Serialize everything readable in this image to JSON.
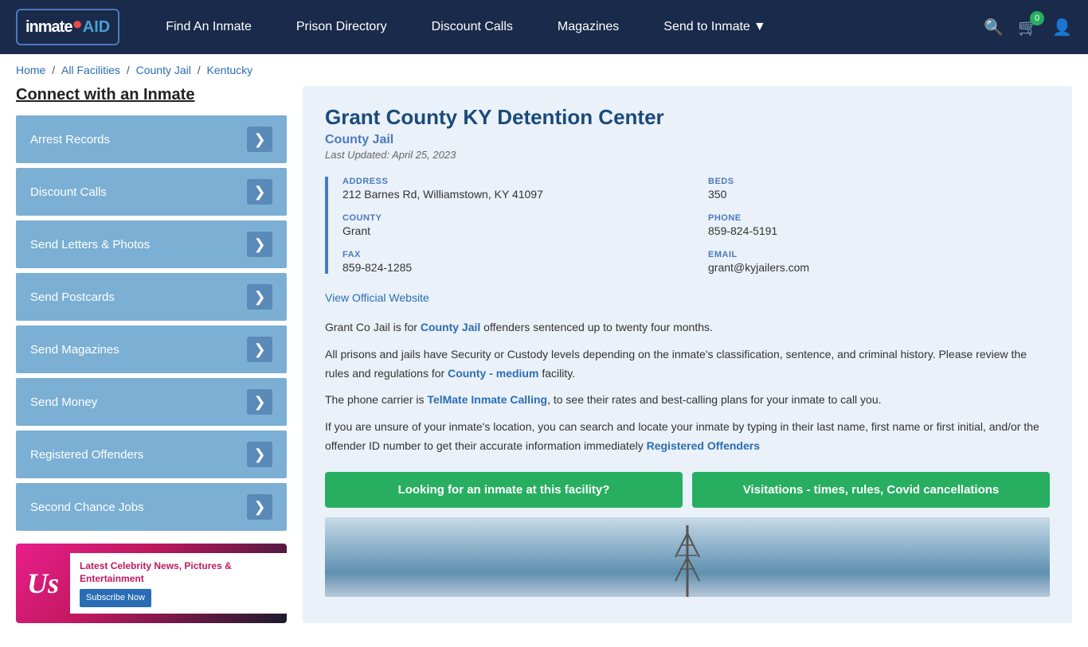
{
  "nav": {
    "logo_text": "inmate",
    "logo_aid": "AID",
    "links": [
      {
        "label": "Find An Inmate",
        "id": "find-inmate"
      },
      {
        "label": "Prison Directory",
        "id": "prison-directory"
      },
      {
        "label": "Discount Calls",
        "id": "discount-calls"
      },
      {
        "label": "Magazines",
        "id": "magazines"
      },
      {
        "label": "Send to Inmate",
        "id": "send-to-inmate",
        "dropdown": true
      }
    ],
    "cart_count": "0"
  },
  "breadcrumb": {
    "items": [
      "Home",
      "All Facilities",
      "County Jail",
      "Kentucky"
    ]
  },
  "sidebar": {
    "title": "Connect with an Inmate",
    "items": [
      {
        "label": "Arrest Records",
        "id": "arrest-records"
      },
      {
        "label": "Discount Calls",
        "id": "discount-calls"
      },
      {
        "label": "Send Letters & Photos",
        "id": "send-letters"
      },
      {
        "label": "Send Postcards",
        "id": "send-postcards"
      },
      {
        "label": "Send Magazines",
        "id": "send-magazines"
      },
      {
        "label": "Send Money",
        "id": "send-money"
      },
      {
        "label": "Registered Offenders",
        "id": "registered-offenders"
      },
      {
        "label": "Second Chance Jobs",
        "id": "second-chance-jobs"
      }
    ],
    "ad": {
      "logo": "Us",
      "headline": "Latest Celebrity News, Pictures & Entertainment",
      "subscribe_label": "Subscribe Now"
    }
  },
  "facility": {
    "title": "Grant County KY Detention Center",
    "subtitle": "County Jail",
    "last_updated": "Last Updated: April 25, 2023",
    "address_label": "ADDRESS",
    "address_value": "212 Barnes Rd, Williamstown, KY 41097",
    "beds_label": "BEDS",
    "beds_value": "350",
    "county_label": "COUNTY",
    "county_value": "Grant",
    "phone_label": "PHONE",
    "phone_value": "859-824-5191",
    "fax_label": "FAX",
    "fax_value": "859-824-1285",
    "email_label": "EMAIL",
    "email_value": "grant@kyjailers.com",
    "official_website_label": "View Official Website",
    "official_website_url": "#",
    "desc1": "Grant Co Jail is for ",
    "desc1_link": "County Jail",
    "desc1_end": " offenders sentenced up to twenty four months.",
    "desc2": "All prisons and jails have Security or Custody levels depending on the inmate's classification, sentence, and criminal history. Please review the rules and regulations for ",
    "desc2_link": "County - medium",
    "desc2_end": " facility.",
    "desc3": "The phone carrier is ",
    "desc3_link": "TelMate Inmate Calling",
    "desc3_end": ", to see their rates and best-calling plans for your inmate to call you.",
    "desc4": "If you are unsure of your inmate's location, you can search and locate your inmate by typing in their last name, first name or first initial, and/or the offender ID number to get their accurate information immediately ",
    "desc4_link": "Registered Offenders",
    "btn1_label": "Looking for an inmate at this facility?",
    "btn2_label": "Visitations - times, rules, Covid cancellations"
  }
}
